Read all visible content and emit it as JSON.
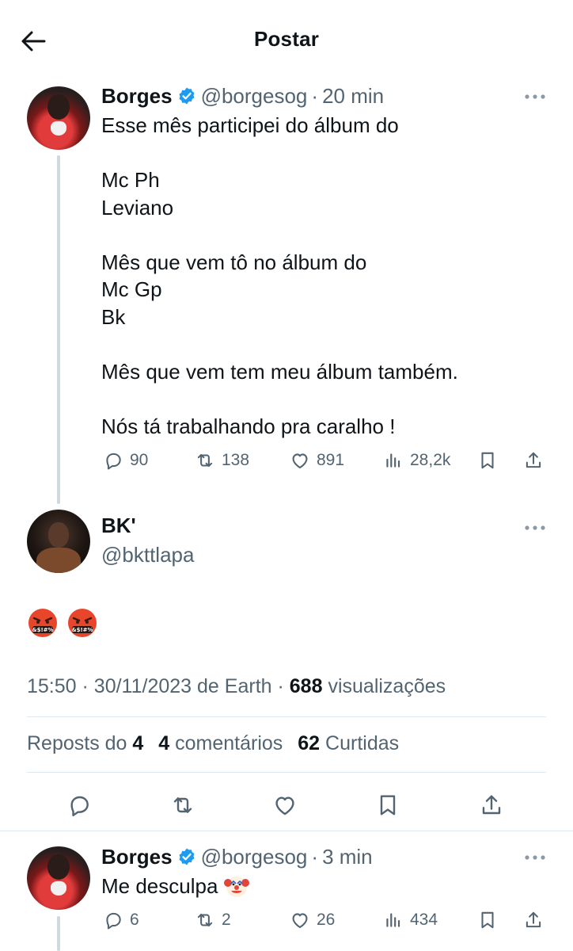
{
  "header": {
    "title": "Postar",
    "back_icon": "arrow-left-icon"
  },
  "colors": {
    "text": "#0f1419",
    "secondary": "#536471",
    "verified": "#1d9bf0",
    "thread_line": "#cfd9de"
  },
  "tweet1": {
    "name": "Borges",
    "handle": "@borgesog",
    "separator": "·",
    "time": "20 min",
    "text": "Esse mês participei do álbum do\n\nMc Ph\nLeviano\n\nMês que vem tô no álbum do\nMc Gp\nBk\n\nMês que vem tem meu álbum também.\n\nNós tá trabalhando pra caralho !",
    "stats": {
      "replies": "90",
      "reposts": "138",
      "likes": "891",
      "views": "28,2k"
    }
  },
  "main": {
    "name": "BK'",
    "handle": "@bkttlapa",
    "emojis": [
      "face-with-symbols-on-mouth",
      "face-with-symbols-on-mouth"
    ],
    "time": "15:50",
    "separator": "·",
    "date": "30/11/2023",
    "source": "de Earth",
    "views_count": "688",
    "views_label": "visualizações",
    "reposts_label": "Reposts do",
    "reposts_count": "4",
    "comments_count": "4",
    "comments_label": "comentários",
    "likes_count": "62",
    "likes_label": "Curtidas"
  },
  "tweet3": {
    "name": "Borges",
    "handle": "@borgesog",
    "separator": "·",
    "time": "3 min",
    "text": "Me desculpa",
    "emoji": "clown-face",
    "stats": {
      "replies": "6",
      "reposts": "2",
      "likes": "26",
      "views": "434"
    }
  }
}
